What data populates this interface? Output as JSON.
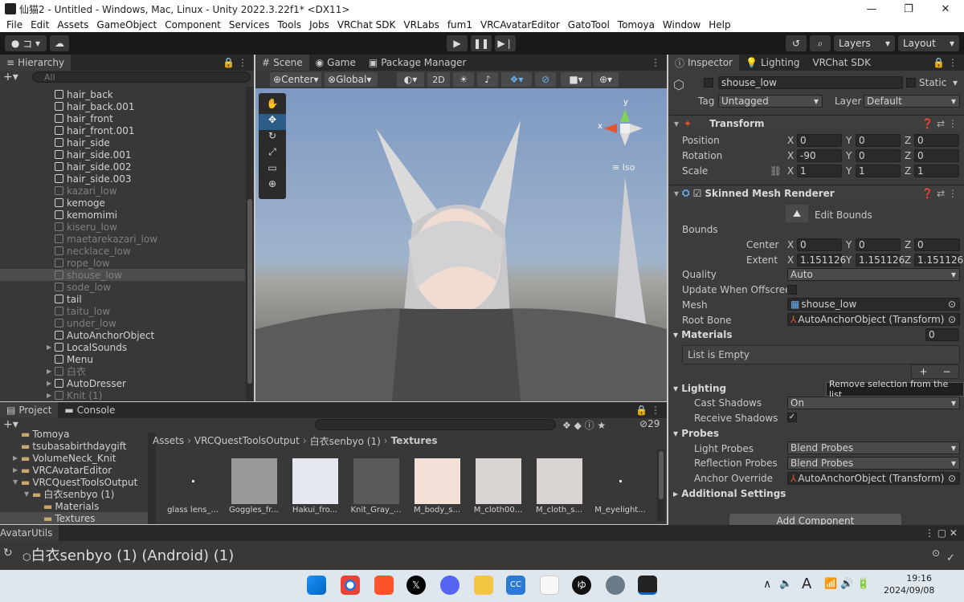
{
  "window": {
    "title": "仙猫2 - Untitled - Windows, Mac, Linux - Unity 2022.3.22f1* <DX11>",
    "min": "—",
    "max": "❐",
    "close": "✕"
  },
  "menu": [
    "File",
    "Edit",
    "Assets",
    "GameObject",
    "Component",
    "Services",
    "Tools",
    "Jobs",
    "VRChat SDK",
    "VRLabs",
    "fum1",
    "VRCAvatarEditor",
    "GatoTool",
    "Tomoya",
    "Window",
    "Help"
  ],
  "toolbar": {
    "account": "コ",
    "layers": "Layers",
    "layout": "Layout"
  },
  "hierarchy": {
    "tab": "Hierarchy",
    "search_placeholder": "All",
    "items": [
      {
        "label": "hair_back",
        "dim": false,
        "indent": 70,
        "arrow": false
      },
      {
        "label": "hair_back.001",
        "dim": false,
        "indent": 70,
        "arrow": false
      },
      {
        "label": "hair_front",
        "dim": false,
        "indent": 70,
        "arrow": false
      },
      {
        "label": "hair_front.001",
        "dim": false,
        "indent": 70,
        "arrow": false
      },
      {
        "label": "hair_side",
        "dim": false,
        "indent": 70,
        "arrow": false
      },
      {
        "label": "hair_side.001",
        "dim": false,
        "indent": 70,
        "arrow": false
      },
      {
        "label": "hair_side.002",
        "dim": false,
        "indent": 70,
        "arrow": false
      },
      {
        "label": "hair_side.003",
        "dim": false,
        "indent": 70,
        "arrow": false
      },
      {
        "label": "kazari_low",
        "dim": true,
        "indent": 70,
        "arrow": false
      },
      {
        "label": "kemoge",
        "dim": false,
        "indent": 70,
        "arrow": false
      },
      {
        "label": "kemomimi",
        "dim": false,
        "indent": 70,
        "arrow": false
      },
      {
        "label": "kiseru_low",
        "dim": true,
        "indent": 70,
        "arrow": false
      },
      {
        "label": "maetarekazari_low",
        "dim": true,
        "indent": 70,
        "arrow": false
      },
      {
        "label": "necklace_low",
        "dim": true,
        "indent": 70,
        "arrow": false
      },
      {
        "label": "rope_low",
        "dim": true,
        "indent": 70,
        "arrow": false
      },
      {
        "label": "shouse_low",
        "dim": true,
        "indent": 70,
        "arrow": false,
        "selected": true
      },
      {
        "label": "sode_low",
        "dim": true,
        "indent": 70,
        "arrow": false
      },
      {
        "label": "tail",
        "dim": false,
        "indent": 70,
        "arrow": false
      },
      {
        "label": "taitu_low",
        "dim": true,
        "indent": 70,
        "arrow": false
      },
      {
        "label": "under_low",
        "dim": true,
        "indent": 70,
        "arrow": false
      },
      {
        "label": "AutoAnchorObject",
        "dim": false,
        "indent": 70,
        "arrow": false
      },
      {
        "label": "LocalSounds",
        "dim": false,
        "indent": 70,
        "arrow": true
      },
      {
        "label": "Menu",
        "dim": false,
        "indent": 70,
        "arrow": false
      },
      {
        "label": "白衣",
        "dim": true,
        "indent": 70,
        "arrow": true
      },
      {
        "label": "AutoDresser",
        "dim": false,
        "indent": 70,
        "arrow": true
      },
      {
        "label": "Knit (1)",
        "dim": true,
        "indent": 70,
        "arrow": true
      }
    ]
  },
  "scene": {
    "tabs": [
      "Scene",
      "Game",
      "Package Manager"
    ],
    "pivot": "Center",
    "space": "Global",
    "mode2d": "2D",
    "iso": "≡ Iso",
    "gizmo_x": "x",
    "gizmo_y": "y"
  },
  "inspector": {
    "tabs": [
      "Inspector",
      "Lighting",
      "VRChat SDK"
    ],
    "name": "shouse_low",
    "static": "Static",
    "tag_label": "Tag",
    "tag": "Untagged",
    "layer_label": "Layer",
    "layer": "Default",
    "transform": {
      "title": "Transform",
      "rows": [
        {
          "label": "Position",
          "x": "0",
          "y": "0",
          "z": "0"
        },
        {
          "label": "Rotation",
          "x": "-90",
          "y": "0",
          "z": "0"
        },
        {
          "label": "Scale",
          "x": "1",
          "y": "1",
          "z": "1"
        }
      ]
    },
    "smr": {
      "title": "Skinned Mesh Renderer",
      "edit_bounds": "Edit Bounds",
      "bounds": "Bounds",
      "center": {
        "label": "Center",
        "x": "0",
        "y": "0",
        "z": "0"
      },
      "extent": {
        "label": "Extent",
        "x": "1.151126",
        "y": "1.151126",
        "z": "1.151126"
      },
      "quality_label": "Quality",
      "quality": "Auto",
      "uwo_label": "Update When Offscreen",
      "mesh_label": "Mesh",
      "mesh": "shouse_low",
      "rootbone_label": "Root Bone",
      "rootbone": "AutoAnchorObject (Transform)",
      "materials_label": "Materials",
      "materials_count": "0",
      "list_empty": "List is Empty",
      "tooltip": "Remove selection from the list",
      "lighting": "Lighting",
      "cast_label": "Cast Shadows",
      "cast": "On",
      "receive_label": "Receive Shadows",
      "probes": "Probes",
      "light_probes_label": "Light Probes",
      "light_probes": "Blend Probes",
      "refl_label": "Reflection Probes",
      "refl": "Blend Probes",
      "anchor_label": "Anchor Override",
      "anchor": "AutoAnchorObject (Transform)",
      "additional": "Additional Settings",
      "add_component": "Add Component"
    }
  },
  "project": {
    "tabs": [
      "Project",
      "Console"
    ],
    "count": "29",
    "breadcrumb": [
      "Assets",
      "VRCQuestToolsOutput",
      "白衣senbyo (1)",
      "Textures"
    ],
    "tree": [
      {
        "label": "Tomoya",
        "indent": 30,
        "arrow": false
      },
      {
        "label": "tsubasabirthdaygift",
        "indent": 30,
        "arrow": false
      },
      {
        "label": "VolumeNeck_Knit",
        "indent": 30,
        "arrow": true
      },
      {
        "label": "VRCAvatarEditor",
        "indent": 30,
        "arrow": true
      },
      {
        "label": "VRCQuestToolsOutput",
        "indent": 30,
        "arrow": true
      },
      {
        "label": "白衣senbyo (1)",
        "indent": 44,
        "arrow": true
      },
      {
        "label": "Materials",
        "indent": 58,
        "arrow": false
      },
      {
        "label": "Textures",
        "indent": 58,
        "arrow": false
      }
    ],
    "assets": [
      "glass lens_...",
      "Goggles_fr...",
      "Hakui_fro...",
      "Knit_Gray_...",
      "M_body_s...",
      "M_cloth00...",
      "M_cloth_s...",
      "M_eyelight..."
    ]
  },
  "avatar_utils": {
    "tab": "AvatarUtils",
    "object": "白衣senbyo (1) (Android) (1)"
  },
  "taskbar": {
    "lang": "A",
    "time": "19:16",
    "date": "2024/09/08"
  },
  "colors": {
    "accent": "#2c5d87",
    "panel": "#383838",
    "header": "#282828",
    "sky": "#8fa7c7"
  }
}
